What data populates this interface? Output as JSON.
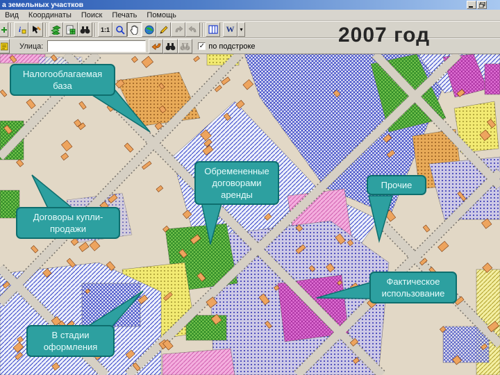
{
  "window": {
    "title": "а земельных участков"
  },
  "menu": {
    "items": [
      "Вид",
      "Координаты",
      "Поиск",
      "Печать",
      "Помощь"
    ]
  },
  "toolbar_main": {
    "scale_button_label": "1:1",
    "w_button_label": "W",
    "year_banner": "2007 год",
    "icons": [
      "info-icon",
      "select-pencil-icon",
      "layers-icon",
      "report-icon",
      "binoculars-icon",
      "scale-1-1",
      "zoom-icon",
      "pan-hand-icon",
      "globe-icon",
      "pencil-icon",
      "undo-icon",
      "redo-icon",
      "columns-icon",
      "w-icon"
    ]
  },
  "toolbar_search": {
    "street_label": "Улица:",
    "street_value": "",
    "substring_checkbox_label": "по подстроке",
    "substring_checked": true,
    "check_glyph": "✓"
  },
  "callouts": [
    {
      "id": "tax-base",
      "text": "Налогооблагаемая база"
    },
    {
      "id": "lease-encumbered",
      "text": "Обремененные договорами аренды"
    },
    {
      "id": "others",
      "text": "Прочие"
    },
    {
      "id": "sale-contracts",
      "text": "Договоры купли-продажи"
    },
    {
      "id": "actual-use",
      "text": "Фактическое использование"
    },
    {
      "id": "in-registration",
      "text": "В стадии оформления"
    }
  ],
  "colors": {
    "callout_fill": "#2da0a0",
    "callout_border": "#0e6e6e",
    "callout_text": "#e8fbfb",
    "titlebar_left": "#2a5ab4",
    "titlebar_right": "#a8c8f0",
    "year_text": "#262626",
    "map_base": "#e2d8c6",
    "parcel_blue": "#2633c0",
    "parcel_green": "#74c44c",
    "parcel_yellow": "#f2ea72",
    "parcel_orange": "#e8aa58",
    "parcel_pink": "#f4aede",
    "parcel_magenta": "#e272d6"
  }
}
